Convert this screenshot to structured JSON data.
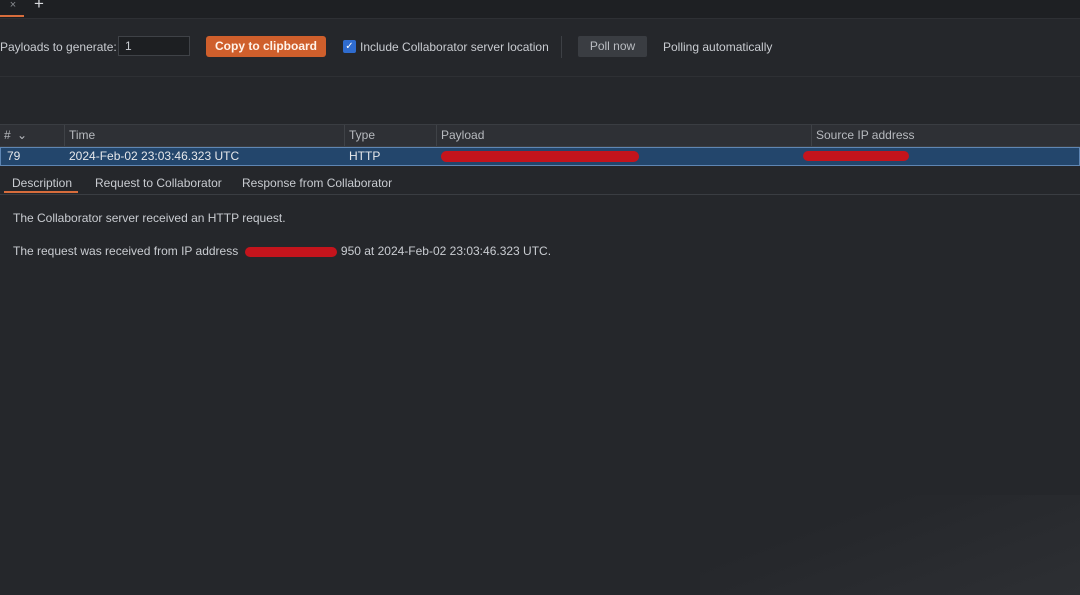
{
  "tabs": {
    "close_glyph": "×",
    "add_glyph": "+"
  },
  "toolbar": {
    "payloads_label": "Payloads to generate:",
    "payloads_value": "1",
    "copy_label": "Copy to clipboard",
    "include_label": "Include Collaborator server location",
    "include_checked": true,
    "poll_label": "Poll now",
    "polling_status": "Polling automatically"
  },
  "table": {
    "columns": [
      "#",
      "Time",
      "Type",
      "Payload",
      "Source IP address"
    ],
    "sort_glyph": "⌄",
    "rows": [
      {
        "num": "79",
        "time": "2024-Feb-02 23:03:46.323 UTC",
        "type": "HTTP"
      }
    ]
  },
  "detail_tabs": [
    "Description",
    "Request to Collaborator",
    "Response from Collaborator"
  ],
  "description": {
    "line1": "The Collaborator server received an HTTP request.",
    "line2_prefix": "The request was received from IP address",
    "line2_suffix": "950 at 2024-Feb-02 23:03:46.323 UTC."
  },
  "colors": {
    "accent_orange": "#cf5f2c",
    "selection_blue": "#23466c",
    "redaction_red": "#c4141c",
    "background": "#25272b"
  },
  "icons": [
    "close-icon",
    "add-tab-icon",
    "checkbox-checked-icon",
    "sort-chevron-icon"
  ]
}
